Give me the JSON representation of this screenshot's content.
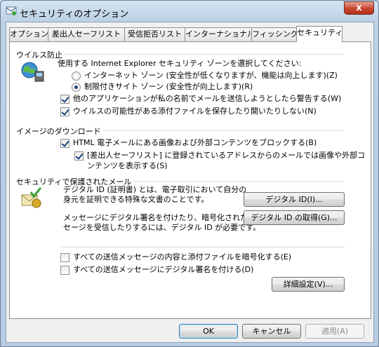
{
  "window": {
    "title": "セキュリティのオプション",
    "close_label": "x"
  },
  "tabs": [
    {
      "label": "オプション",
      "active": false
    },
    {
      "label": "差出人セーフリスト",
      "active": false
    },
    {
      "label": "受信拒否リスト",
      "active": false
    },
    {
      "label": "インターナショナル",
      "active": false
    },
    {
      "label": "フィッシング",
      "active": false
    },
    {
      "label": "セキュリティ",
      "active": true
    }
  ],
  "virus": {
    "title": "ウイルス防止",
    "zone_prompt": "使用する Internet Explorer セキュリティ ゾーンを選択してください:",
    "zone_internet": "インターネット ゾーン (安全性が低くなりますが、機能は向上します)(Z)",
    "zone_restricted": "制限付きサイト ゾーン (安全性が向上します)(R)",
    "warn_send": "他のアプリケーションが私の名前でメールを送信しようとしたら警告する(W)",
    "block_attachments": "ウイルスの可能性がある添付ファイルを保存したり開いたりしない(N)"
  },
  "images": {
    "title": "イメージのダウンロード",
    "block_html": "HTML 電子メールにある画像および外部コンテンツをブロックする(B)",
    "safe_line1": "[差出人セーフリスト] に登録されているアドレスからのメールでは画像や外部コ",
    "safe_line2": "ンテンツを表示する(S)"
  },
  "secure": {
    "title": "セキュリティで保護されたメール",
    "id_line1": "デジタル ID (証明書) とは、電子取引において自分の",
    "id_line2": "身元を証明できる特殊な文書のことです。",
    "digital_id_button": "デジタル ID(I)...",
    "sign_line1": "メッセージにデジタル署名を付けたり、暗号化されたメッ",
    "sign_line2": "セージを受信したりするには、デジタル ID が必要です。",
    "get_id_button": "デジタル ID の取得(G)...",
    "encrypt_all": "すべての送信メッセージの内容と添付ファイルを暗号化する(E)",
    "sign_all": "すべての送信メッセージにデジタル署名を付ける(D)",
    "advanced_button": "詳細設定(V)..."
  },
  "footer": {
    "ok": "OK",
    "cancel": "キャンセル",
    "apply": "適用(A)"
  }
}
